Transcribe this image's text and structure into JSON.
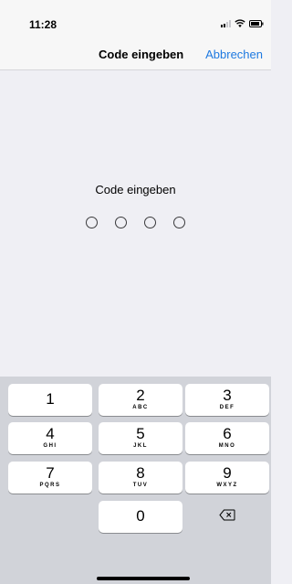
{
  "status_bar": {
    "time": "11:28"
  },
  "nav": {
    "title": "Code eingeben",
    "cancel": "Abbrechen"
  },
  "prompt": "Code eingeben",
  "code_length": 4,
  "keypad": {
    "keys": [
      {
        "digit": "1",
        "letters": ""
      },
      {
        "digit": "2",
        "letters": "ABC"
      },
      {
        "digit": "3",
        "letters": "DEF"
      },
      {
        "digit": "4",
        "letters": "GHI"
      },
      {
        "digit": "5",
        "letters": "JKL"
      },
      {
        "digit": "6",
        "letters": "MNO"
      },
      {
        "digit": "7",
        "letters": "PQRS"
      },
      {
        "digit": "8",
        "letters": "TUV"
      },
      {
        "digit": "9",
        "letters": "WXYZ"
      },
      {
        "digit": "0",
        "letters": ""
      }
    ],
    "delete_icon": "delete-backspace-icon"
  },
  "colors": {
    "accent": "#1f7ae0",
    "background": "#efeff4",
    "keypad_background": "#d1d3d9"
  }
}
